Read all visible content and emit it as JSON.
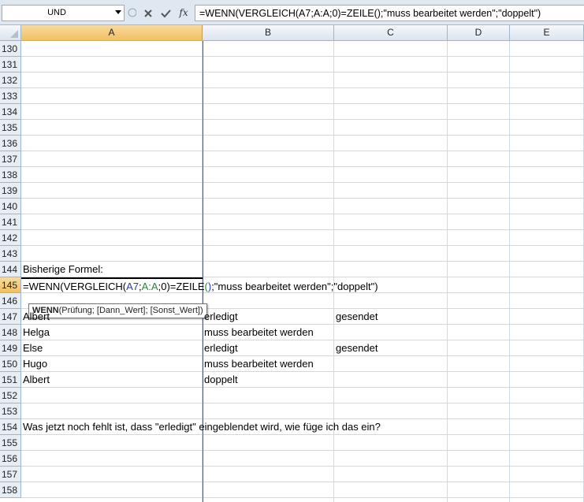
{
  "name_box": {
    "value": "UND"
  },
  "formula_bar": {
    "value": "=WENN(VERGLEICH(A7;A:A;0)=ZEILE();\"muss bearbeitet werden\";\"doppelt\")",
    "cancel_icon": "cancel-icon",
    "enter_icon": "enter-icon",
    "fx_label": "fx"
  },
  "columns": [
    "A",
    "B",
    "C",
    "D",
    "E"
  ],
  "active_column": "A",
  "rows": [
    "130",
    "131",
    "132",
    "133",
    "134",
    "135",
    "136",
    "137",
    "138",
    "139",
    "140",
    "141",
    "142",
    "143",
    "144",
    "145",
    "146",
    "147",
    "148",
    "149",
    "150",
    "151",
    "152",
    "153",
    "154",
    "155",
    "156",
    "157",
    "158"
  ],
  "active_row": "145",
  "cells": {
    "A144": "Bisherige Formel:",
    "A147": "Albert",
    "B147": "erledigt",
    "C147": "gesendet",
    "A148": "Helga",
    "B148": "muss bearbeitet werden",
    "A149": "Else",
    "B149": "erledigt",
    "C149": "gesendet",
    "A150": "Hugo",
    "B150": "muss bearbeitet werden",
    "A151": "Albert",
    "B151": "doppelt",
    "A154": "Was jetzt noch fehlt ist, dass \"erledigt\" eingeblendet wird, wie füge ich das ein?"
  },
  "edit_cell": {
    "address": "A145",
    "parts": {
      "p1": "=WENN(VERGLEICH(",
      "p2": "A7",
      "p3": ";",
      "p4": "A:A",
      "p5": ";0)=ZEILE",
      "p6": "(",
      "p7": ")",
      "p8": ";\"muss bearbeitet werden\";\"doppelt\")"
    }
  },
  "tooltip": {
    "function_name": "WENN",
    "arguments": "(Prüfung; [Dann_Wert]; [Sonst_Wert])"
  },
  "colors": {
    "ref_a7": "#1f3fbf",
    "ref_aa": "#1f8a2e",
    "page_break": "#2e7d32",
    "active_header": "#f1c15f"
  }
}
